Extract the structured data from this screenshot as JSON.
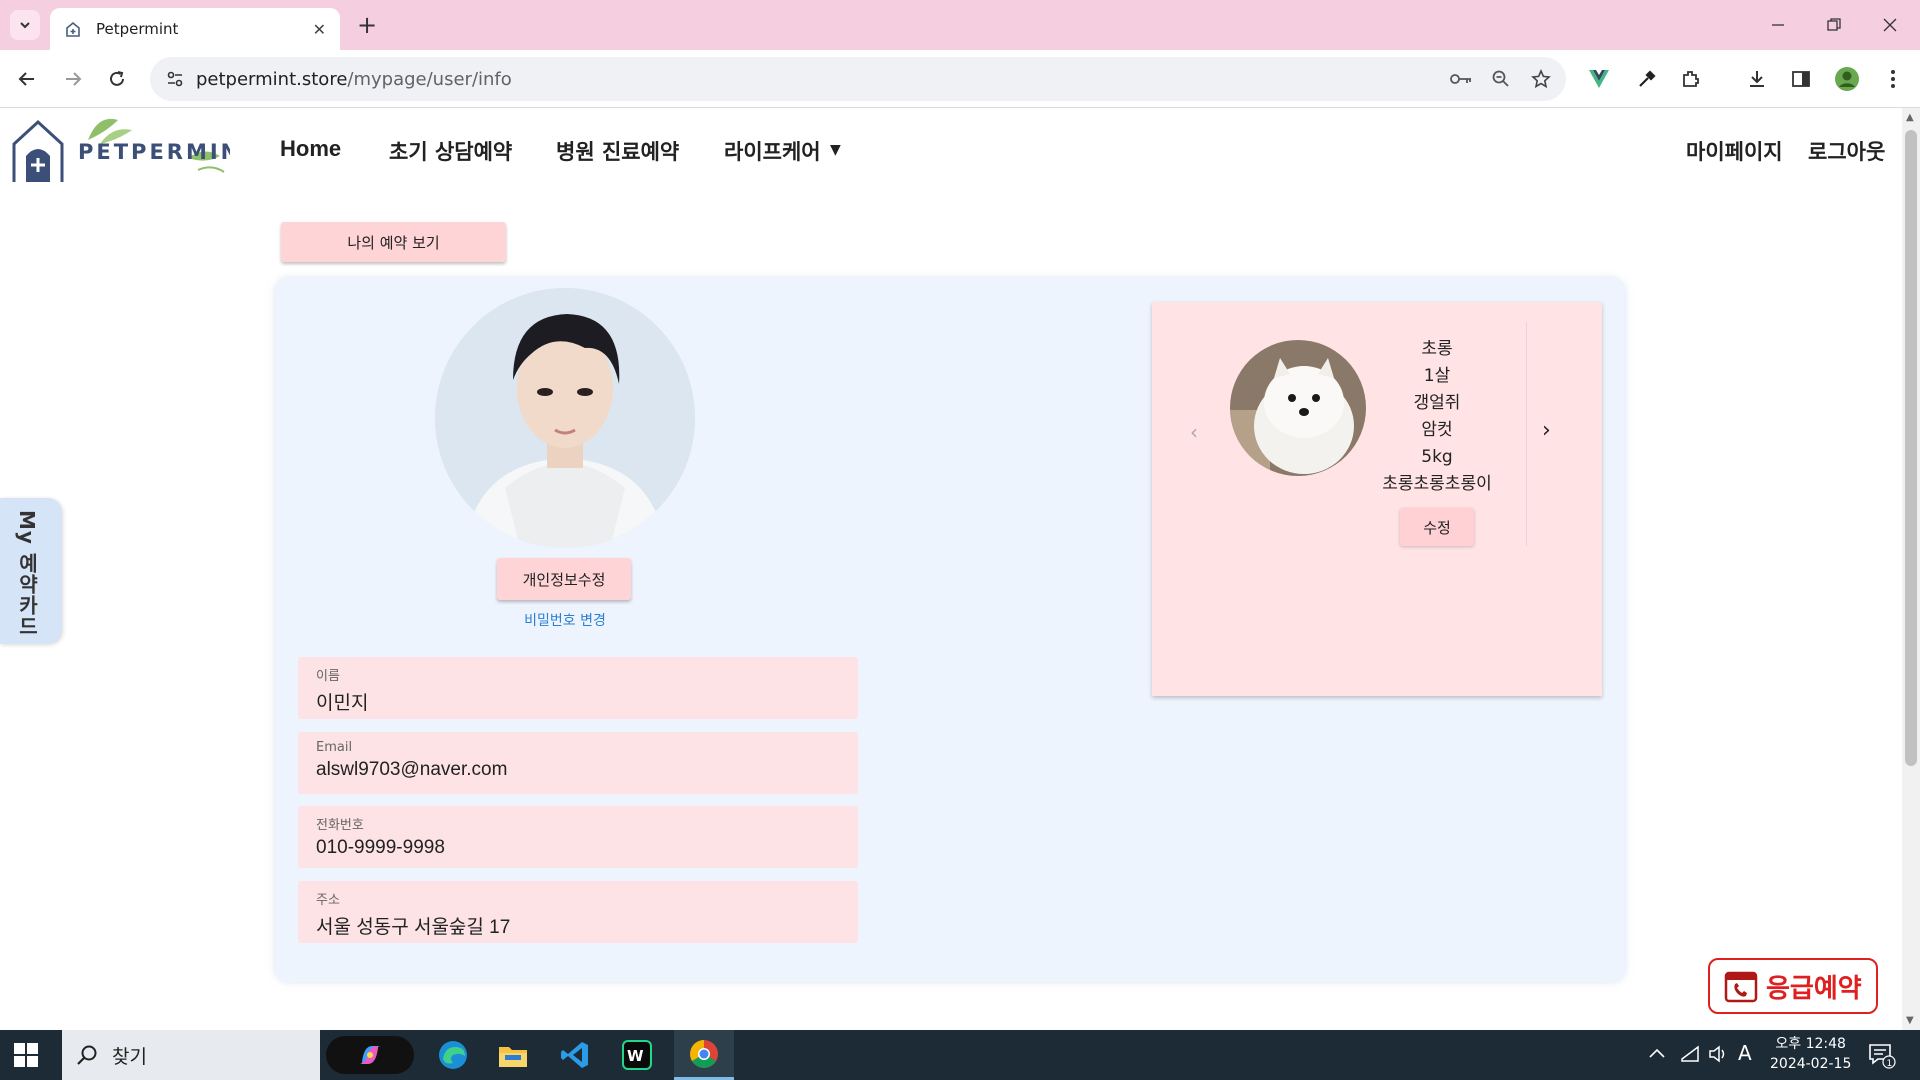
{
  "browser": {
    "tab_title": "Petpermint",
    "url_host": "petpermint.store",
    "url_path": "/mypage/user/info",
    "new_tab_symbol": "+",
    "tab_close_symbol": "✕"
  },
  "site": {
    "logo_text": "PETPERMINT",
    "nav": {
      "home": "Home",
      "consult": "초기 상담예약",
      "hospital": "병원 진료예약",
      "lifecare": "라이프케어",
      "lifecare_caret": "▼",
      "mypage": "마이페이지",
      "logout": "로그아웃"
    }
  },
  "page": {
    "reserve_button": "나의 예약 보기",
    "edit_profile_button": "개인정보수정",
    "password_link": "비밀번호 변경",
    "fields": [
      {
        "label": "이름",
        "value": "이민지"
      },
      {
        "label": "Email",
        "value": "alswl9703@naver.com"
      },
      {
        "label": "전화번호",
        "value": "010-9999-9998"
      },
      {
        "label": "주소",
        "value": "서울 성동구 서울숲길 17"
      }
    ],
    "pet": {
      "name": "초롱",
      "age": "1살",
      "breed": "갱얼쥐",
      "sex": "암컷",
      "weight": "5kg",
      "memo": "초롱초롱초롱이",
      "edit_button": "수정",
      "prev": "‹",
      "next": "›"
    },
    "side_tab": "My 예약카드",
    "emergency_button": "응급예약"
  },
  "taskbar": {
    "search_placeholder": "찾기",
    "ime": "A",
    "time": "오후 12:48",
    "date": "2024-02-15",
    "notification_count": "1"
  },
  "colors": {
    "tabbar": "#f5cfe0",
    "button_pink": "#ffd4d6",
    "field_pink": "#fde3e5",
    "panel_blue": "#eef4fd",
    "emergency_red": "#e02020",
    "link_blue": "#2a7fd4"
  }
}
